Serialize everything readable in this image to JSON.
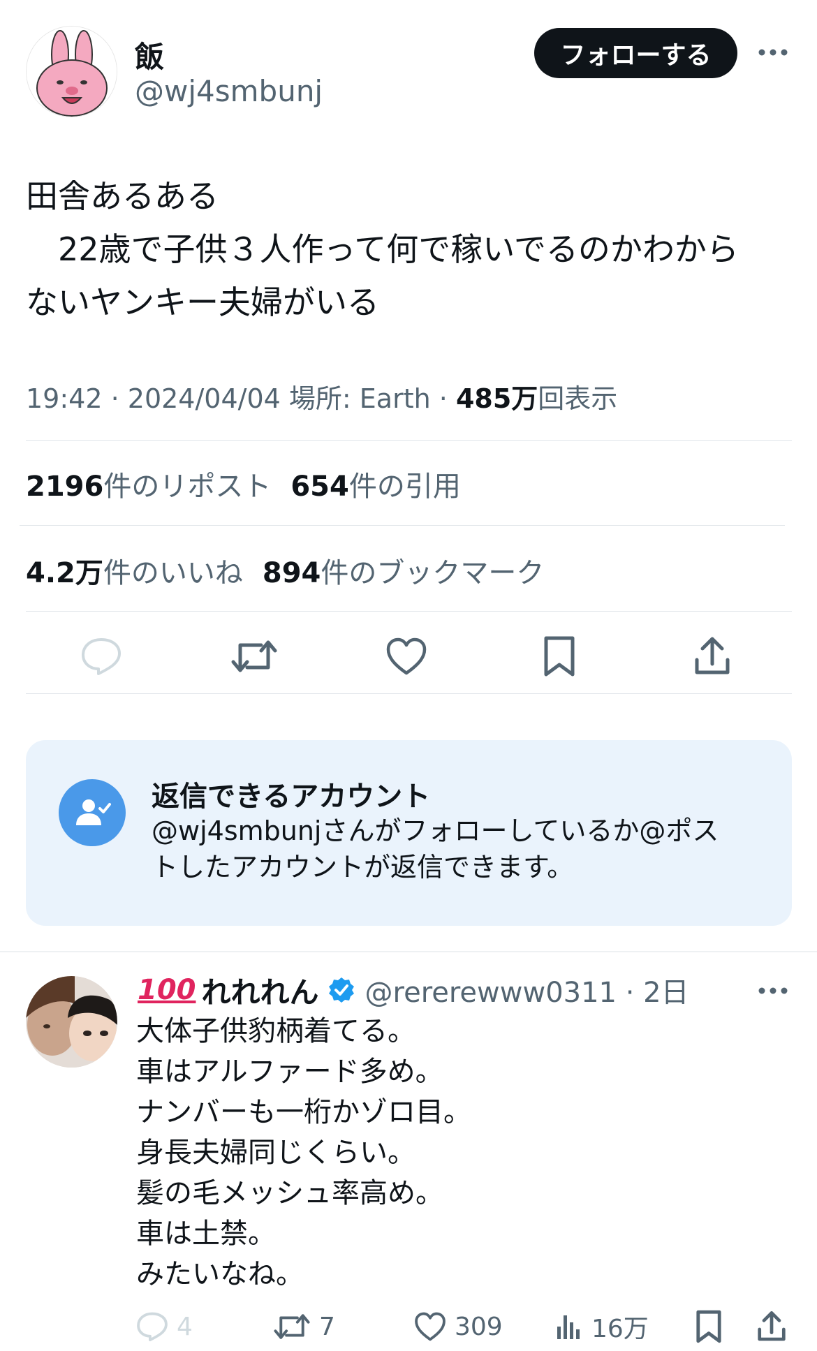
{
  "tweet": {
    "display_name": "飯",
    "handle": "@wj4smbunj",
    "follow_label": "フォローする",
    "text": "田舎あるある\n　22歳で子供３人作って何で稼いでるのかわから\nないヤンキー夫婦がいる",
    "time": "19:42",
    "date": "2024/04/04",
    "location_prefix": "場所: Earth",
    "views_count": "485万",
    "views_label": "回表示",
    "stats": {
      "reposts_count": "2196",
      "reposts_label": "件のリポスト",
      "quotes_count": "654",
      "quotes_label": "件の引用",
      "likes_count": "4.2万",
      "likes_label": "件のいいね",
      "bookmarks_count": "894",
      "bookmarks_label": "件のブックマーク"
    }
  },
  "icons": {
    "reply": "reply-icon",
    "retweet": "retweet-icon",
    "like": "heart-icon",
    "bookmark": "bookmark-icon",
    "share": "share-icon",
    "more": "more-icon",
    "views": "views-icon",
    "verified": "verified-badge-icon",
    "notice": "person-check-icon"
  },
  "notice": {
    "title": "返信できるアカウント",
    "body": "@wj4smbunjさんがフォローしているか@ポス\nトしたアカウントが返信できます。"
  },
  "reply": {
    "emoji": "100",
    "display_name": "れれれん",
    "handle_time": "@rererewww0311 · 2日",
    "text": "大体子供豹柄着てる。\n車はアルファード多め。\nナンバーも一桁かゾロ目。\n身長夫婦同じくらい。\n髪の毛メッシュ率高め。\n車は土禁。\nみたいなね。",
    "replies": "4",
    "retweets": "7",
    "likes": "309",
    "views": "16万"
  },
  "colors": {
    "accent": "#1d9bf0",
    "text_primary": "#0f1419",
    "text_secondary": "#536471",
    "notice_bg": "#eaf3fc",
    "follow_bg": "#0f1419"
  }
}
